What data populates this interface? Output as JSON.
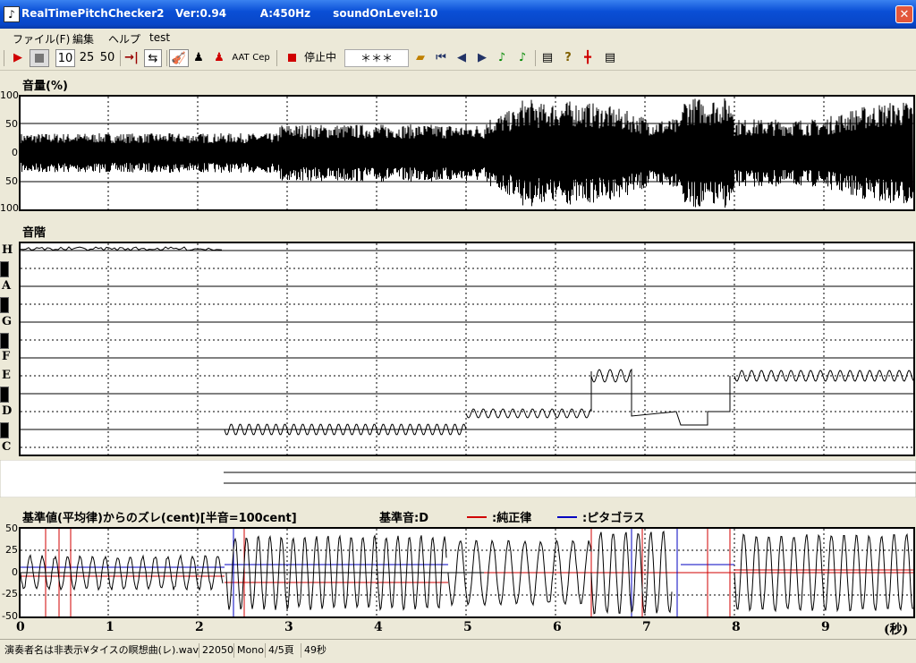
{
  "window": {
    "title": "RealTimePitchChecker2   Ver:0.94         A:450Hz      soundOnLevel:10",
    "close_label": "✕"
  },
  "menu": [
    "ファイル(F)",
    "編集",
    "ヘルプ",
    "test"
  ],
  "toolbar": {
    "btn_10": "10",
    "btn_25": "25",
    "btn_50": "50",
    "btn_aat": "AAT",
    "btn_cep": "Cep",
    "status": "停止中",
    "note_display": "＊＊＊"
  },
  "volume": {
    "label": "音量(%)",
    "ticks": [
      "100",
      "50",
      "0",
      "50",
      "100"
    ]
  },
  "scale": {
    "label": "音階",
    "notes": [
      "H",
      "A",
      "G",
      "F",
      "E",
      "D",
      "C"
    ]
  },
  "deviation": {
    "label": "基準値(平均律)からのズレ(cent)[半音=100cent]",
    "base_note": "基準音:D",
    "legend_just": ":純正律",
    "legend_pyth": ":ピタゴラス",
    "ticks": [
      "50",
      "25",
      "0",
      "-25",
      "-50"
    ],
    "just_color": "#d00000",
    "pyth_color": "#0000c0"
  },
  "time_axis": {
    "ticks": [
      "0",
      "1",
      "2",
      "3",
      "4",
      "5",
      "6",
      "7",
      "8",
      "9"
    ],
    "unit": "(秒)"
  },
  "statusbar": {
    "file": "演奏者名は非表示¥タイスの瞑想曲(レ).wav",
    "rate": "22050",
    "channels": "Mono",
    "page": "4/5頁",
    "duration": "49秒"
  }
}
